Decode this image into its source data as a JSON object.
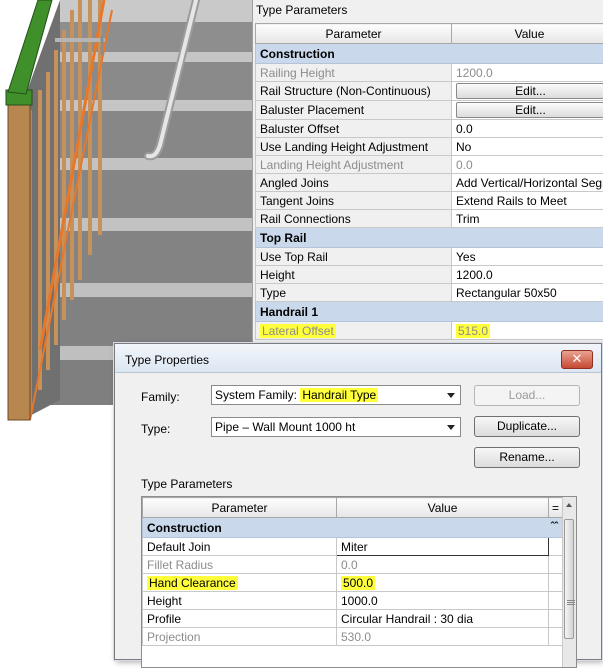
{
  "background_panel": {
    "title": "Type Parameters",
    "columns": {
      "parameter": "Parameter",
      "value": "Value"
    },
    "groups": [
      {
        "name": "Construction"
      },
      {
        "name": "Top Rail"
      },
      {
        "name": "Handrail 1"
      }
    ],
    "rows": [
      {
        "param": "Railing Height",
        "value": "1200.0"
      },
      {
        "param": "Rail Structure (Non-Continuous)",
        "value": "Edit..."
      },
      {
        "param": "Baluster Placement",
        "value": "Edit..."
      },
      {
        "param": "Baluster Offset",
        "value": "0.0"
      },
      {
        "param": "Use Landing Height Adjustment",
        "value": "No"
      },
      {
        "param": "Landing Height Adjustment",
        "value": "0.0"
      },
      {
        "param": "Angled Joins",
        "value": "Add Vertical/Horizontal Segments"
      },
      {
        "param": "Tangent Joins",
        "value": "Extend Rails to Meet"
      },
      {
        "param": "Rail Connections",
        "value": "Trim"
      },
      {
        "param": "Use Top Rail",
        "value": "Yes"
      },
      {
        "param": "Height",
        "value": "1200.0"
      },
      {
        "param": "Type",
        "value": "Rectangular 50x50"
      },
      {
        "param": "Lateral Offset",
        "value": "515.0"
      }
    ]
  },
  "dialog": {
    "title": "Type Properties",
    "close_label": "✕",
    "family_label": "Family:",
    "family_prefix": "System Family: ",
    "family_value": "Handrail Type",
    "type_label": "Type:",
    "type_value": "Pipe – Wall Mount 1000 ht",
    "load_button": "Load...",
    "duplicate_button": "Duplicate...",
    "rename_button": "Rename...",
    "params_title": "Type Parameters",
    "columns": {
      "parameter": "Parameter",
      "value": "Value",
      "sort": "="
    },
    "group": "Construction",
    "collapse_icon": "chevron-up-double-icon",
    "rows": [
      {
        "param": "Default Join",
        "value": "Miter"
      },
      {
        "param": "Fillet Radius",
        "value": "0.0"
      },
      {
        "param": "Hand Clearance",
        "value": "500.0"
      },
      {
        "param": "Height",
        "value": "1000.0"
      },
      {
        "param": "Profile",
        "value": "Circular Handrail : 30 dia"
      },
      {
        "param": "Projection",
        "value": "530.0"
      }
    ]
  },
  "colors": {
    "highlight": "#ffff3c",
    "group_header": "#c9d8ea",
    "stair_step": "#8c8c8c",
    "baluster_orange": "#e8772a",
    "wood_post": "#b8874f",
    "top_rail_green": "#3f8f2b"
  }
}
